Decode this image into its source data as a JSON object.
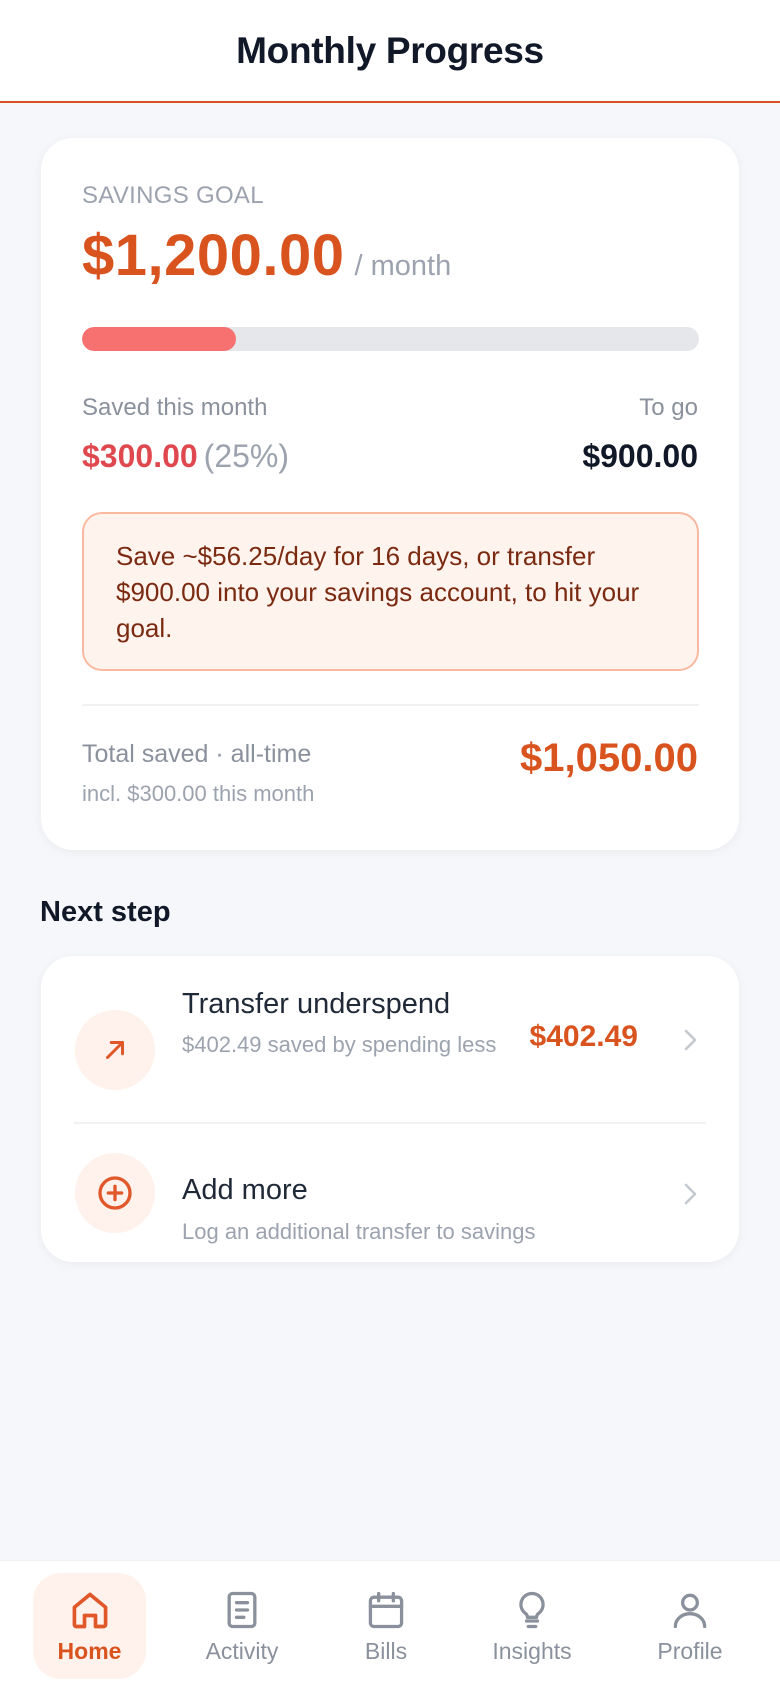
{
  "header": {
    "title": "Monthly Progress"
  },
  "goal": {
    "label": "SAVINGS GOAL",
    "amount": "$1,200.00",
    "period": "/ month",
    "progress_fraction": 0.25,
    "saved_label": "Saved this month",
    "saved_amount": "$300.00",
    "saved_percent": "(25%)",
    "togo_label": "To go",
    "togo_amount": "$900.00",
    "tip": "Save ~$56.25/day for 16 days, or transfer $900.00 into your savings account, to hit your goal.",
    "total_label": "Total saved · all-time",
    "total_sub": "incl. $300.00 this month",
    "total_amount": "$1,050.00"
  },
  "next_step": {
    "title": "Next step",
    "items": [
      {
        "title": "Transfer underspend",
        "subtitle": "$402.49 saved by spending less",
        "amount": "$402.49",
        "icon": "arrow-up-right-icon"
      },
      {
        "title": "Add more",
        "subtitle": "Log an additional transfer to savings",
        "icon": "plus-circle-icon"
      }
    ]
  },
  "nav": {
    "items": [
      {
        "label": "Home",
        "icon": "home-icon",
        "active": true
      },
      {
        "label": "Activity",
        "icon": "document-icon",
        "active": false
      },
      {
        "label": "Bills",
        "icon": "calendar-icon",
        "active": false
      },
      {
        "label": "Insights",
        "icon": "lightbulb-icon",
        "active": false
      },
      {
        "label": "Profile",
        "icon": "person-icon",
        "active": false
      }
    ]
  },
  "colors": {
    "accent": "#d9531e",
    "progress": "#f87171",
    "saved": "#e0484f",
    "tip_bg": "#fff3ee",
    "tip_border": "#f9b9a1"
  }
}
